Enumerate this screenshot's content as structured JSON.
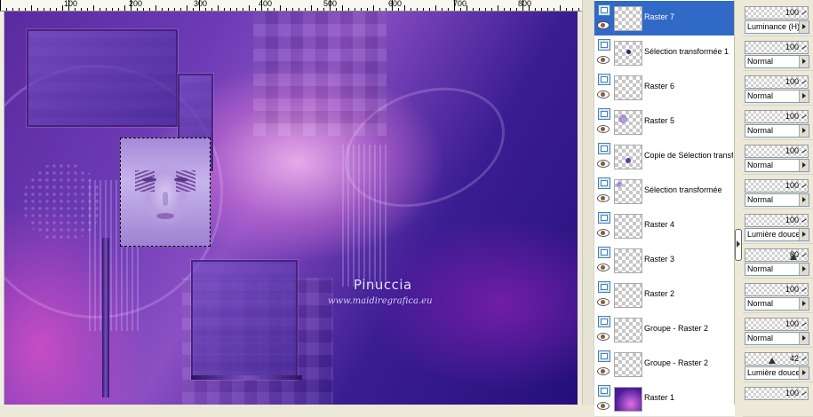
{
  "ruler": {
    "labels": [
      "100",
      "200",
      "300",
      "400",
      "500",
      "600",
      "700",
      "800"
    ]
  },
  "watermark": {
    "name": "Pinuccia",
    "url": "www.maidiregrafica.eu"
  },
  "layers": [
    {
      "name": "Raster 7",
      "selected": true,
      "opacity": "100",
      "blend": "Luminance (H)"
    },
    {
      "name": "Sélection transformée 1",
      "selected": false,
      "opacity": "100",
      "blend": "Normal"
    },
    {
      "name": "Raster 6",
      "selected": false,
      "opacity": "100",
      "blend": "Normal"
    },
    {
      "name": "Raster 5",
      "selected": false,
      "opacity": "100",
      "blend": "Normal"
    },
    {
      "name": "Copie de Sélection transf",
      "selected": false,
      "opacity": "100",
      "blend": "Normal"
    },
    {
      "name": "Sélection transformée",
      "selected": false,
      "opacity": "100",
      "blend": "Normal"
    },
    {
      "name": "Raster 4",
      "selected": false,
      "opacity": "100",
      "blend": "Lumière douce"
    },
    {
      "name": "Raster 3",
      "selected": false,
      "opacity": "80",
      "opacity_level": 0.8,
      "blend": "Normal"
    },
    {
      "name": "Raster 2",
      "selected": false,
      "opacity": "100",
      "blend": "Normal"
    },
    {
      "name": "Groupe - Raster 2",
      "selected": false,
      "opacity": "100",
      "blend": "Normal"
    },
    {
      "name": "Groupe - Raster 2",
      "selected": false,
      "opacity": "42",
      "opacity_level": 0.42,
      "blend": "Lumière douce"
    },
    {
      "name": "Raster 1",
      "selected": false,
      "opacity": "100",
      "blend": ""
    }
  ],
  "icons": {
    "layer_type": "raster-layer-icon",
    "visibility": "eye-icon",
    "collapse": "collapse-arrow-icon",
    "dropdown": "dropdown-arrow-icon"
  },
  "colors": {
    "selection": "#3169c6",
    "canvas_dark": "#24107a",
    "canvas_mid": "#6d3cb5",
    "canvas_light": "#ebafeb"
  }
}
